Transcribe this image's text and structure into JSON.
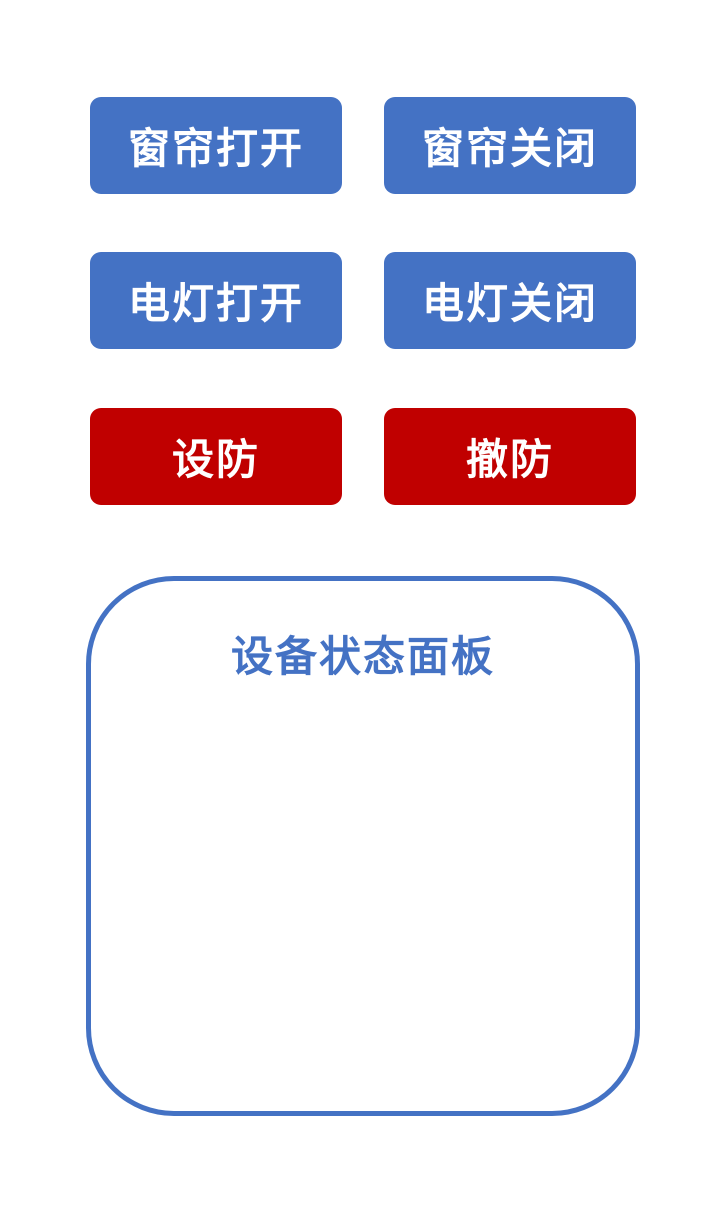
{
  "controls": {
    "curtain_open": "窗帘打开",
    "curtain_close": "窗帘关闭",
    "light_on": "电灯打开",
    "light_off": "电灯关闭",
    "arm": "设防",
    "disarm": "撤防"
  },
  "status_panel": {
    "title": "设备状态面板"
  },
  "colors": {
    "primary_blue": "#4472C4",
    "alarm_red": "#C00000",
    "background": "#FFFFFF"
  }
}
